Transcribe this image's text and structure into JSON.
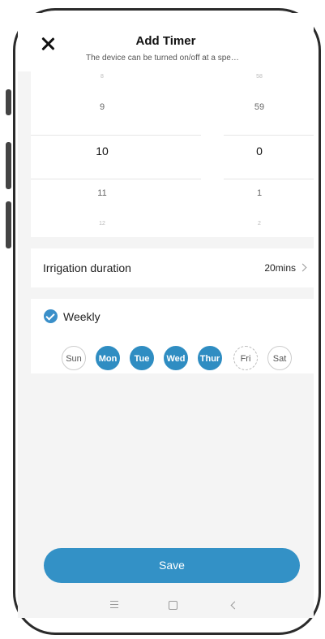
{
  "header": {
    "title": "Add Timer",
    "subtitle": "The device can be turned on/off at a spe…"
  },
  "picker": {
    "hours": [
      "8",
      "9",
      "10",
      "11",
      "12"
    ],
    "minutes": [
      "58",
      "59",
      "0",
      "1",
      "2"
    ],
    "selected_hour": "10",
    "selected_minute": "0"
  },
  "irrigation": {
    "label": "Irrigation duration",
    "value": "20mins"
  },
  "weekly": {
    "label": "Weekly",
    "checked": true,
    "days": [
      {
        "label": "Sun",
        "selected": false
      },
      {
        "label": "Mon",
        "selected": true
      },
      {
        "label": "Tue",
        "selected": true
      },
      {
        "label": "Wed",
        "selected": true
      },
      {
        "label": "Thur",
        "selected": true
      },
      {
        "label": "Fri",
        "selected": false
      },
      {
        "label": "Sat",
        "selected": false
      }
    ]
  },
  "save_label": "Save",
  "colors": {
    "accent": "#2f8dc2",
    "background": "#f4f4f4"
  },
  "nav": {
    "icons": [
      "menu-icon",
      "home-icon",
      "back-icon"
    ]
  }
}
